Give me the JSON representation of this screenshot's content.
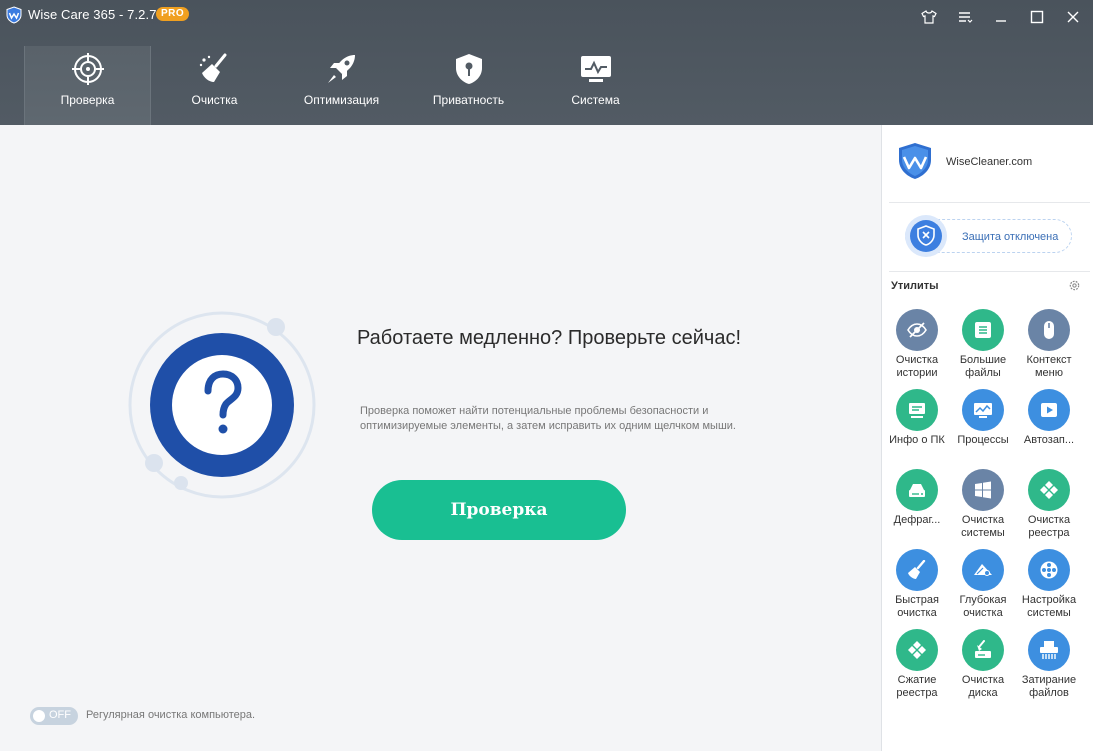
{
  "window": {
    "title": "Wise Care 365 - 7.2.7",
    "badge": "PRO"
  },
  "nav": {
    "items": [
      {
        "label": "Проверка",
        "icon": "target-icon",
        "active": true
      },
      {
        "label": "Очистка",
        "icon": "broom-icon"
      },
      {
        "label": "Оптимизация",
        "icon": "rocket-icon"
      },
      {
        "label": "Приватность",
        "icon": "shield-lock-icon"
      },
      {
        "label": "Система",
        "icon": "monitor-icon"
      }
    ]
  },
  "main": {
    "headline": "Работаете медленно? Проверьте сейчас!",
    "description": "Проверка поможет найти потенциальные проблемы безопасности и оптимизируемые элементы, а затем исправить их одним щелчком мыши.",
    "scan_button": "Проверка",
    "schedule_toggle": {
      "state": "OFF",
      "label": "Регулярная очистка компьютера."
    }
  },
  "sidebar": {
    "brand": "WiseCleaner.com",
    "protection_status": "Защита отключена",
    "utilities_title": "Утилиты",
    "tools": [
      {
        "label": "Очистка\nистории",
        "icon": "eye-off-icon",
        "color": "#6a84a6"
      },
      {
        "label": "Большие\nфайлы",
        "icon": "list-icon",
        "color": "#2fb88a"
      },
      {
        "label": "Контекст\nменю",
        "icon": "mouse-icon",
        "color": "#6a84a6"
      },
      {
        "label": "Инфо о ПК",
        "icon": "pc-info-icon",
        "color": "#2fb88a"
      },
      {
        "label": "Процессы",
        "icon": "process-chart-icon",
        "color": "#3d8fe0"
      },
      {
        "label": "Автозап...",
        "icon": "autostart-icon",
        "color": "#3d8fe0"
      },
      {
        "label": "Дефраг...",
        "icon": "defrag-icon",
        "color": "#2fb88a"
      },
      {
        "label": "Очистка\nсистемы",
        "icon": "windows-icon",
        "color": "#6a84a6"
      },
      {
        "label": "Очистка\nреестра",
        "icon": "registry-icon",
        "color": "#2fb88a"
      },
      {
        "label": "Быстрая\nочистка",
        "icon": "quick-clean-icon",
        "color": "#3d8fe0"
      },
      {
        "label": "Глубокая\nочистка",
        "icon": "deep-clean-icon",
        "color": "#3d8fe0"
      },
      {
        "label": "Настройка\nсистемы",
        "icon": "system-tune-icon",
        "color": "#3d8fe0"
      },
      {
        "label": "Сжатие\nреестра",
        "icon": "registry-compress-icon",
        "color": "#2fb88a"
      },
      {
        "label": "Очистка\nдиска",
        "icon": "disk-clean-icon",
        "color": "#2fb88a"
      },
      {
        "label": "Затирание\nфайлов",
        "icon": "shredder-icon",
        "color": "#3d8fe0"
      }
    ]
  }
}
